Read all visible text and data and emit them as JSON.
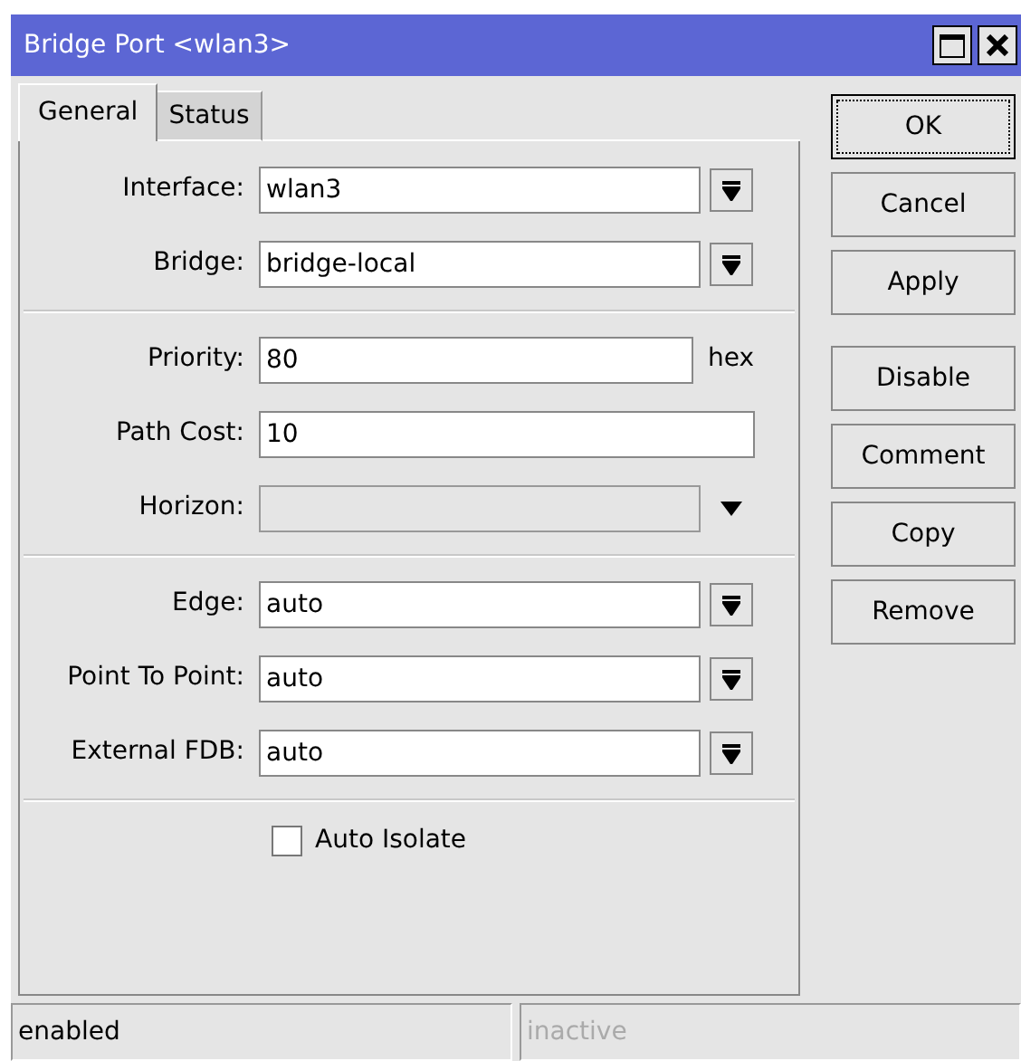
{
  "window": {
    "title": "Bridge Port <wlan3>"
  },
  "tabs": [
    {
      "label": "General",
      "selected": true
    },
    {
      "label": "Status",
      "selected": false
    }
  ],
  "sections": [
    {
      "fields": [
        {
          "label": "Interface:",
          "kind": "dropdown",
          "value": "wlan3"
        },
        {
          "label": "Bridge:",
          "kind": "dropdown",
          "value": "bridge-local"
        }
      ]
    },
    {
      "fields": [
        {
          "label": "Priority:",
          "kind": "text",
          "value": "80",
          "unit": "hex"
        },
        {
          "label": "Path Cost:",
          "kind": "text",
          "value": "10"
        },
        {
          "label": "Horizon:",
          "kind": "disabled_dropdown"
        }
      ]
    },
    {
      "fields": [
        {
          "label": "Edge:",
          "kind": "dropdown",
          "value": "auto"
        },
        {
          "label": "Point To Point:",
          "kind": "dropdown",
          "value": "auto"
        },
        {
          "label": "External FDB:",
          "kind": "dropdown",
          "value": "auto"
        }
      ]
    }
  ],
  "auto_isolate": {
    "label": "Auto Isolate",
    "checked": false
  },
  "button_groups": [
    {
      "buttons": [
        {
          "label": "OK",
          "focused": true
        },
        {
          "label": "Cancel",
          "focused": false
        },
        {
          "label": "Apply",
          "focused": false
        }
      ]
    },
    {
      "buttons": [
        {
          "label": "Disable",
          "focused": false
        },
        {
          "label": "Comment",
          "focused": false
        },
        {
          "label": "Copy",
          "focused": false
        },
        {
          "label": "Remove",
          "focused": false
        }
      ]
    }
  ],
  "status_bar": [
    {
      "text": "enabled",
      "disabled": false
    },
    {
      "text": "inactive",
      "disabled": true
    }
  ]
}
